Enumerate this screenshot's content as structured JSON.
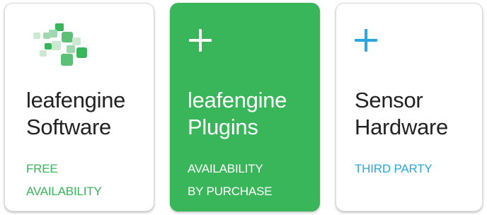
{
  "colors": {
    "green": "#39b55a",
    "blue": "#2aa7e0",
    "text": "#222222"
  },
  "cards": [
    {
      "icon": "leafengine-logo-icon",
      "title_line1": "leafengine",
      "title_line2": "Software",
      "sub_line1": "FREE",
      "sub_line2": "AVAILABILITY"
    },
    {
      "icon": "plus-icon",
      "title_line1": "leafengine",
      "title_line2": "Plugins",
      "sub_line1": "AVAILABILITY",
      "sub_line2": "BY PURCHASE"
    },
    {
      "icon": "plus-icon",
      "title_line1": "Sensor",
      "title_line2": "Hardware",
      "sub_line1": "THIRD PARTY",
      "sub_line2": ""
    }
  ]
}
